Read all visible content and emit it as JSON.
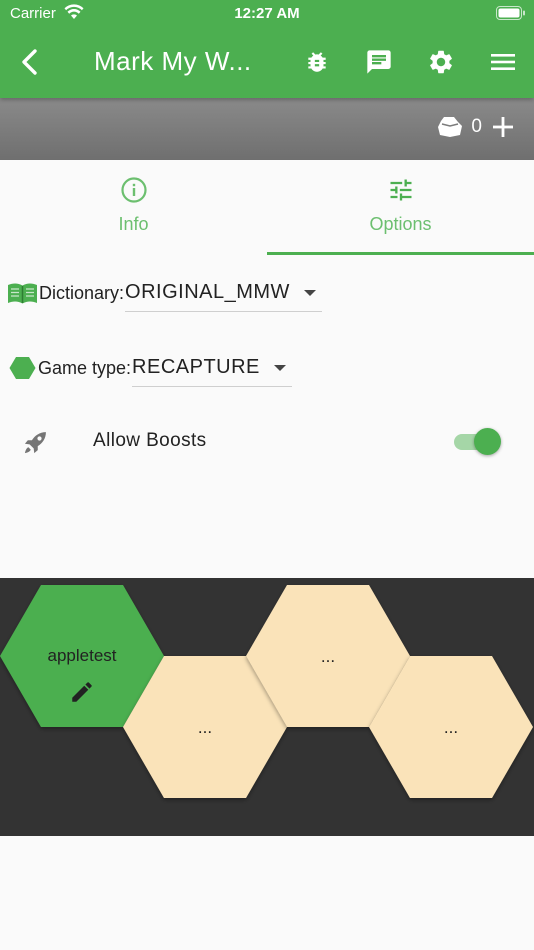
{
  "status_bar": {
    "carrier": "Carrier",
    "time": "12:27 AM"
  },
  "app_bar": {
    "title": "Mark My W...",
    "icons": [
      "back-arrow-icon",
      "bug-icon",
      "chat-icon",
      "gear-icon",
      "menu-icon"
    ]
  },
  "sub_bar": {
    "coin_count": "0",
    "icons": [
      "coins-icon",
      "plus-icon"
    ]
  },
  "tabs": [
    {
      "label": "Info",
      "icon": "info-icon",
      "selected": false
    },
    {
      "label": "Options",
      "icon": "tune-icon",
      "selected": true
    }
  ],
  "options": {
    "dictionary_label": "Dictionary:",
    "dictionary_value": "ORIGINAL_MMW",
    "game_type_label": "Game type:",
    "game_type_value": "RECAPTURE",
    "boosts_label": "Allow Boosts",
    "boosts_enabled": true
  },
  "board": {
    "player_name": "appletest",
    "empty_slots": [
      "...",
      "...",
      "..."
    ]
  },
  "colors": {
    "accent": "#4caf50",
    "tab_active": "#6cbf6f",
    "board_bg": "#333333",
    "hex_player": "#4caf50",
    "hex_empty": "#fae3b9"
  }
}
